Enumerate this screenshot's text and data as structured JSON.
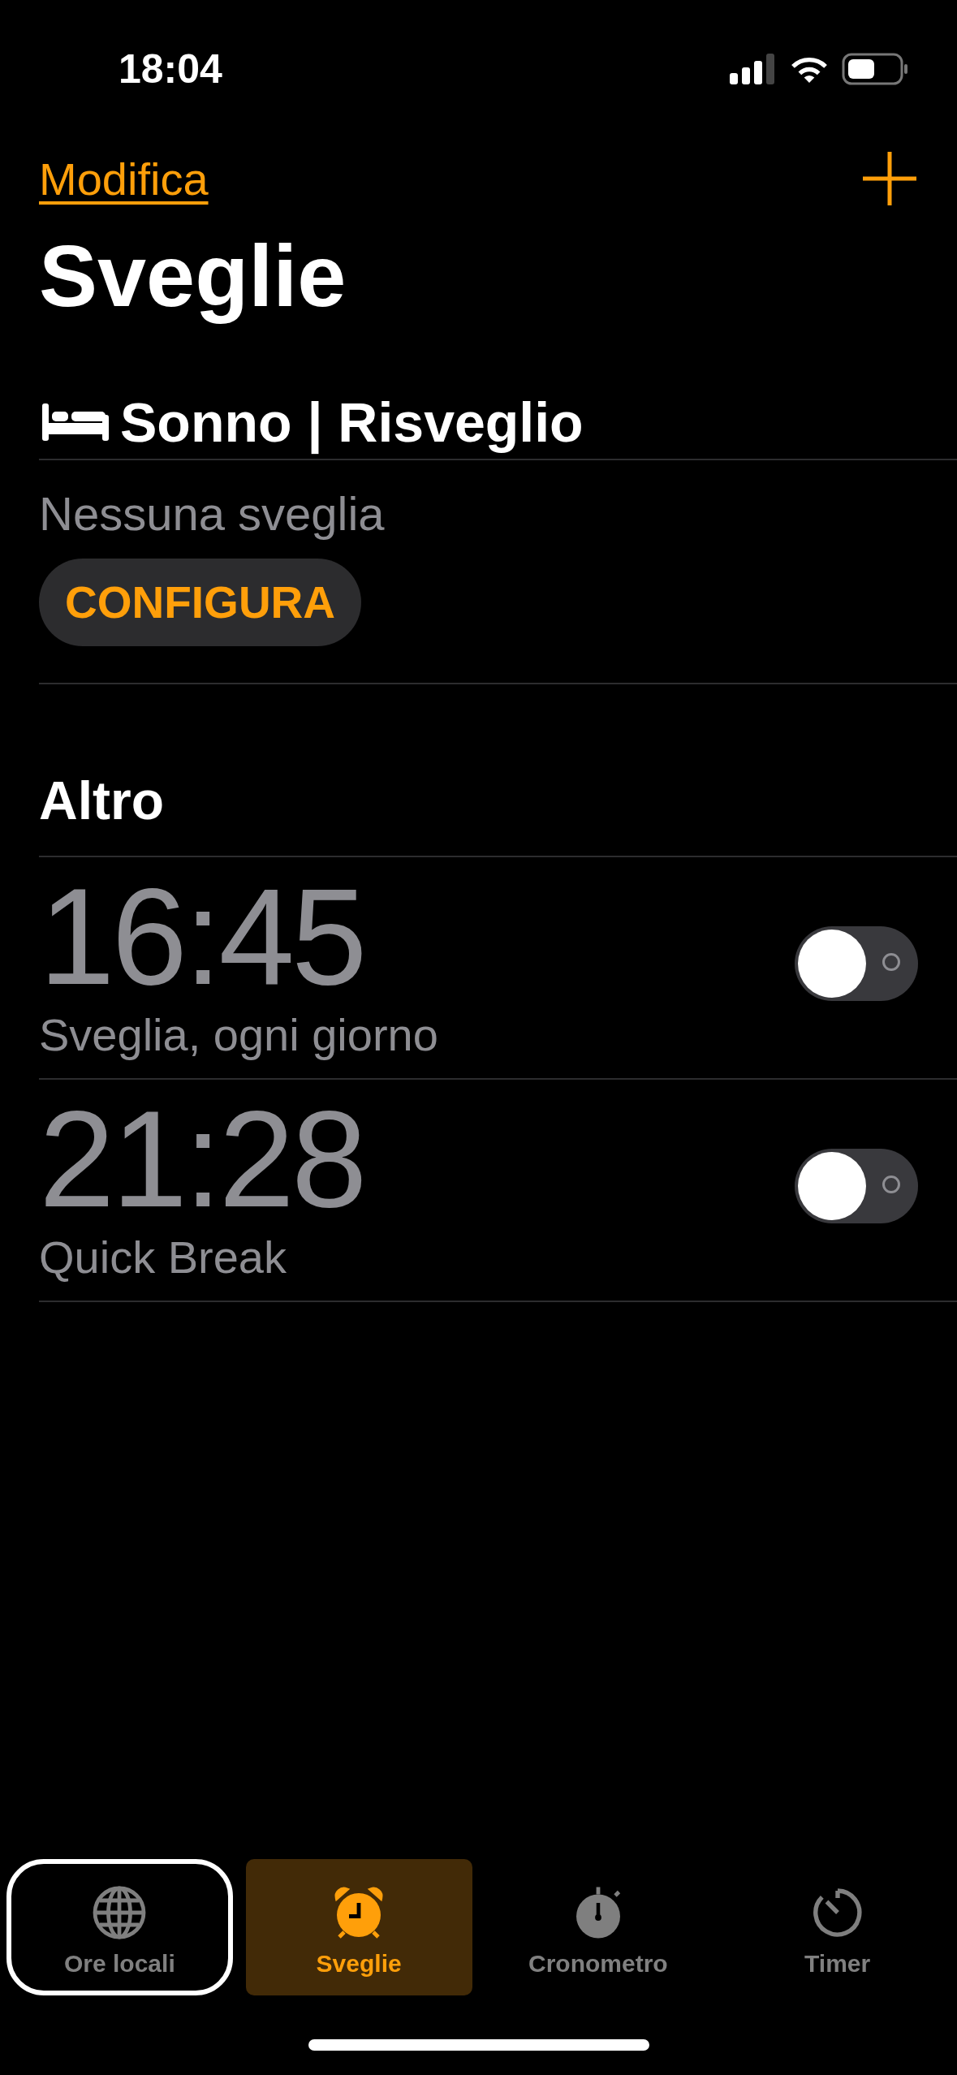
{
  "status_bar": {
    "time": "18:04"
  },
  "nav": {
    "edit_link": "Modifica"
  },
  "title": "Sveglie",
  "sleep_section": {
    "title": "Sonno | Risveglio",
    "empty_text": "Nessuna sveglia",
    "button": "CONFIGURA"
  },
  "other_section": {
    "title": "Altro"
  },
  "alarms": [
    {
      "time": "16:45",
      "label": "Sveglia, ogni giorno",
      "on": false
    },
    {
      "time": "21:28",
      "label": "Quick Break",
      "on": false
    }
  ],
  "tabs": [
    {
      "kind": "globe",
      "label": "Ore locali",
      "selected": false,
      "focused": true
    },
    {
      "kind": "alarm",
      "label": "Sveglie",
      "selected": true,
      "focused": false
    },
    {
      "kind": "stopwatch",
      "label": "Cronometro",
      "selected": false,
      "focused": false
    },
    {
      "kind": "timer",
      "label": "Timer",
      "selected": false,
      "focused": false
    }
  ]
}
